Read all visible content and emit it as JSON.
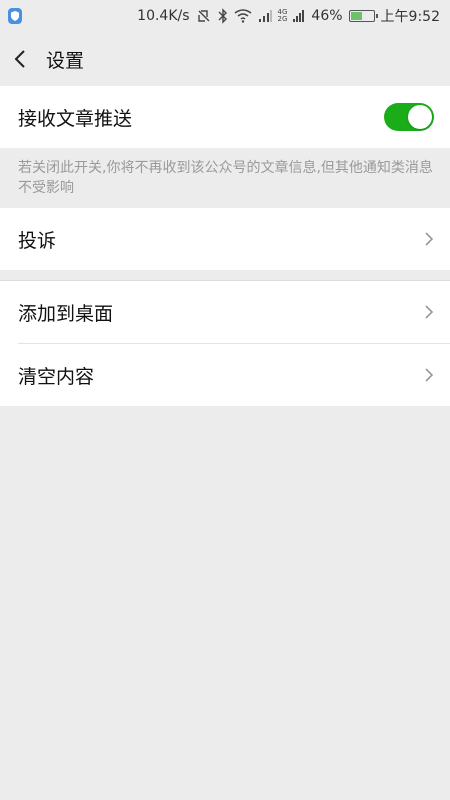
{
  "status_bar": {
    "network_speed": "10.4K/s",
    "battery_percent": "46%",
    "time": "上午9:52",
    "network_type": "4G",
    "network_type_2": "2G",
    "battery_level": 0.46,
    "icons": [
      "app-shield-icon",
      "nfc-icon",
      "bluetooth-icon",
      "wifi-icon",
      "signal-icon",
      "battery-icon"
    ]
  },
  "header": {
    "title": "设置"
  },
  "settings": {
    "receive_articles": {
      "label": "接收文章推送",
      "enabled": true
    },
    "note": "若关闭此开关,你将不再收到该公众号的文章信息,但其他通知类消息不受影响",
    "complain": "投诉",
    "add_to_desktop": "添加到桌面",
    "clear_content": "清空内容"
  },
  "colors": {
    "accent": "#1aad19",
    "background": "#ececec"
  }
}
